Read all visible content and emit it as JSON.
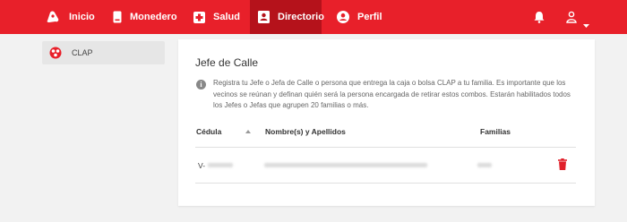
{
  "nav": {
    "items": [
      {
        "label": "Inicio",
        "icon": "home-icon"
      },
      {
        "label": "Monedero",
        "icon": "wallet-icon"
      },
      {
        "label": "Salud",
        "icon": "health-cross-icon"
      },
      {
        "label": "Directorio",
        "icon": "contact-card-icon"
      },
      {
        "label": "Perfil",
        "icon": "account-circle-icon"
      }
    ],
    "active": "Directorio",
    "right_icons": [
      "bell-icon",
      "user-icon",
      "caret-down-icon"
    ]
  },
  "sidebar": {
    "items": [
      {
        "label": "CLAP",
        "icon": "clap-logo-icon"
      }
    ]
  },
  "card": {
    "title": "Jefe de Calle",
    "info_icon": "info-icon",
    "info_text": "Registra tu Jefe o Jefa de Calle o persona que entrega la caja o bolsa CLAP a tu familia. Es importante que los vecinos se reúnan y definan quién será la persona encargada de retirar estos combos. Estarán habilitados todos los Jefes o Jefas que agrupen 20 familias o más."
  },
  "table": {
    "columns": [
      "Cédula",
      "Nombre(s) y Apellidos",
      "Familias"
    ],
    "rows": [
      {
        "cedula_prefix": "V-",
        "action_icon": "trash-icon"
      }
    ]
  },
  "colors": {
    "brand_red": "#e8202a",
    "active_red": "#b5121b",
    "delete_red": "#e0202a"
  }
}
